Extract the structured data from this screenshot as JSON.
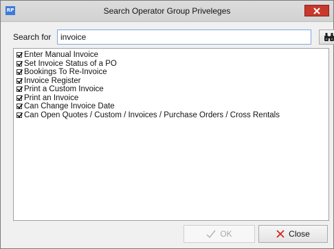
{
  "window": {
    "title": "Search Operator Group Priveleges",
    "app_icon_text": "RP"
  },
  "search": {
    "label": "Search for",
    "value": "invoice"
  },
  "results": [
    {
      "label": "Enter Manual Invoice",
      "checked": true
    },
    {
      "label": "Set Invoice Status of a PO",
      "checked": true
    },
    {
      "label": "Bookings To Re-Invoice",
      "checked": true
    },
    {
      "label": "Invoice Register",
      "checked": true
    },
    {
      "label": "Print a Custom Invoice",
      "checked": true
    },
    {
      "label": "Print an Invoice",
      "checked": true
    },
    {
      "label": "Can Change Invoice Date",
      "checked": true
    },
    {
      "label": "Can Open Quotes / Custom / Invoices / Purchase Orders / Cross Rentals",
      "checked": true
    }
  ],
  "buttons": {
    "ok_label": "OK",
    "close_label": "Close"
  },
  "icons": {
    "title_close": "close-icon",
    "find": "binoculars-icon",
    "ok": "checkmark-icon",
    "close": "x-icon"
  },
  "colors": {
    "title_close_bg": "#c8382c",
    "close_x": "#d42020",
    "input_border": "#7aa7e3"
  }
}
